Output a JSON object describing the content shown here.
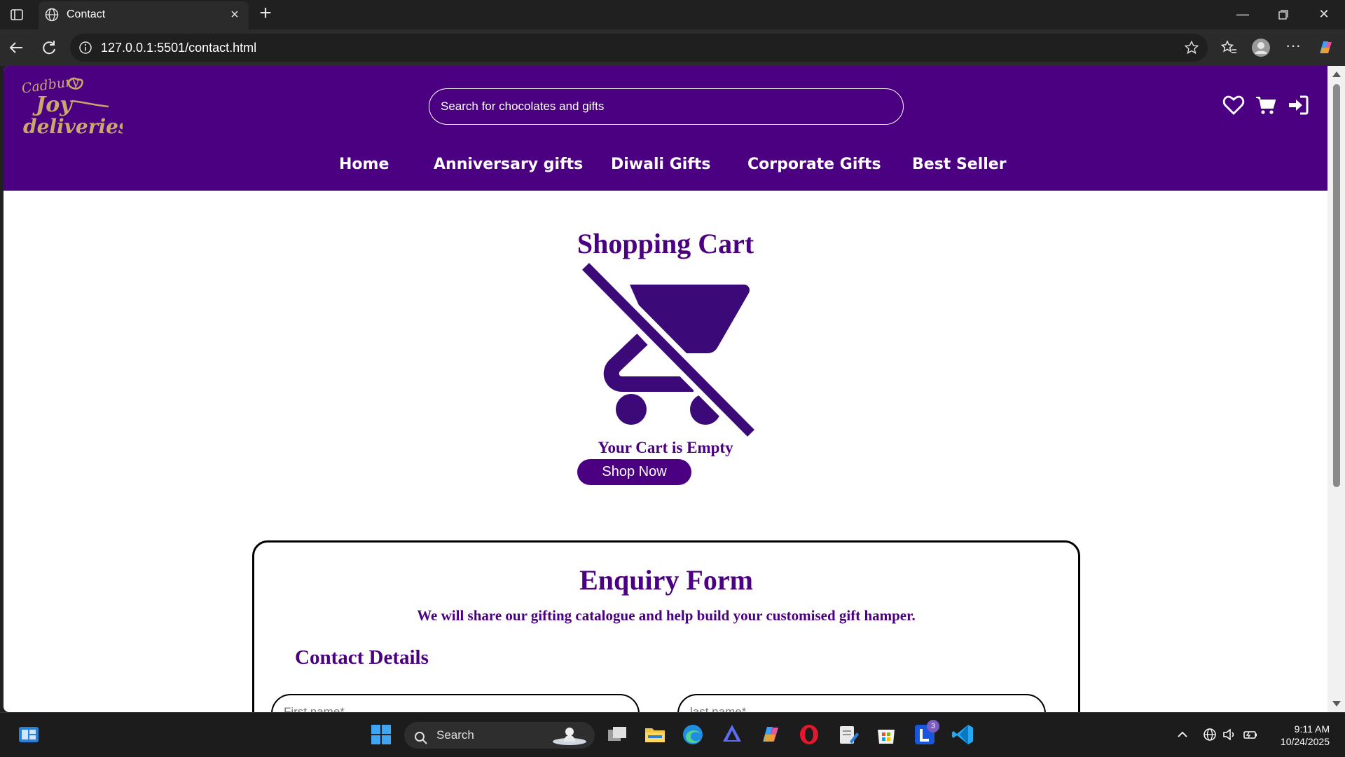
{
  "browser": {
    "tab_title": "Contact",
    "url": "127.0.0.1:5501/contact.html"
  },
  "site": {
    "logo_text_top": "Cadbury",
    "logo_text_mid": "Joy",
    "logo_text_bottom": "deliveries",
    "search_placeholder": "Search for chocolates and gifts",
    "nav": [
      "Home",
      "Anniversary gifts",
      "Diwali Gifts",
      "Corporate Gifts",
      "Best Seller"
    ],
    "colors": {
      "brand": "#4b0082",
      "logo_gold": "#c9a86a"
    }
  },
  "cart": {
    "title": "Shopping Cart",
    "empty_message": "Your Cart is Empty",
    "shop_button": "Shop Now"
  },
  "enquiry": {
    "title": "Enquiry Form",
    "subtitle": "We will share our gifting catalogue and help build your customised gift hamper.",
    "section_heading": "Contact Details",
    "first_name_placeholder": "First name*",
    "last_name_placeholder": "last name*"
  },
  "taskbar": {
    "search_label": "Search",
    "time": "9:11 AM",
    "date": "10/24/2025",
    "notification_count": "3"
  }
}
